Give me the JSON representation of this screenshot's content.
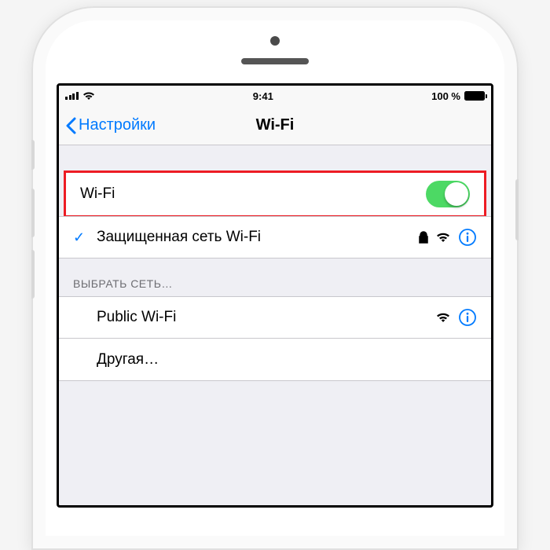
{
  "status_bar": {
    "time": "9:41",
    "battery_text": "100 %"
  },
  "nav": {
    "back_label": "Настройки",
    "title": "Wi-Fi"
  },
  "wifi_toggle": {
    "label": "Wi-Fi",
    "on": true
  },
  "connected_network": {
    "name": "Защищенная сеть Wi-Fi",
    "secured": true
  },
  "section_header": "выбрать сеть…",
  "networks": [
    {
      "name": "Public Wi-Fi",
      "secured": false
    },
    {
      "name": "Другая…",
      "is_other": true
    }
  ],
  "colors": {
    "ios_blue": "#007aff",
    "toggle_green": "#4cd964",
    "highlight_red": "#ed1c24"
  }
}
